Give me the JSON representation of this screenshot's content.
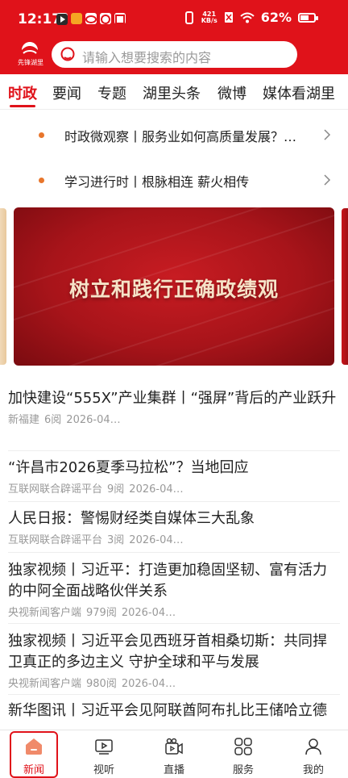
{
  "status_bar": {
    "time": "12:17",
    "net_speed_value": "421",
    "net_speed_unit": "KB/s",
    "battery_percent": "62%",
    "battery_level": 0.62
  },
  "header": {
    "logo_text": "先锋湖里",
    "search_placeholder": "请输入想要搜索的内容"
  },
  "tabs": [
    {
      "label": "时政"
    },
    {
      "label": "要闻"
    },
    {
      "label": "专题"
    },
    {
      "label": "湖里头条"
    },
    {
      "label": "微博"
    },
    {
      "label": "媒体看湖里"
    }
  ],
  "headlines": [
    {
      "text": "时政微观察丨服务业如何高质量发展？…"
    },
    {
      "text": "学习进行时丨根脉相连 薪火相传"
    }
  ],
  "banner": {
    "title": "树立和践行正确政绩观"
  },
  "news": [
    {
      "title": "加快建设“555X”产业集群丨“强屏”背后的产业跃升",
      "source": "新福建",
      "reads": "6阅",
      "date": "2026-04…"
    },
    {
      "title": "“许昌市2026夏季马拉松”？当地回应",
      "source": "互联网联合辟谣平台",
      "reads": "9阅",
      "date": "2026-04…"
    },
    {
      "title": "人民日报：警惕财经类自媒体三大乱象",
      "source": "互联网联合辟谣平台",
      "reads": "3阅",
      "date": "2026-04…"
    },
    {
      "title": "独家视频丨习近平：打造更加稳固坚韧、富有活力的中阿全面战略伙伴关系",
      "source": "央视新闻客户端",
      "reads": "979阅",
      "date": "2026-04…"
    },
    {
      "title": "独家视频丨习近平会见西班牙首相桑切斯：共同捍卫真正的多边主义 守护全球和平与发展",
      "source": "央视新闻客户端",
      "reads": "980阅",
      "date": "2026-04…"
    },
    {
      "title": "新华图讯丨习近平会见阿联酋阿布扎比王储哈立德",
      "source": "",
      "reads": "",
      "date": ""
    }
  ],
  "bottom_nav": [
    {
      "label": "新闻",
      "icon": "home-icon"
    },
    {
      "label": "视听",
      "icon": "video-icon"
    },
    {
      "label": "直播",
      "icon": "live-camera-icon"
    },
    {
      "label": "服务",
      "icon": "grid-icon"
    },
    {
      "label": "我的",
      "icon": "person-icon"
    }
  ],
  "colors": {
    "brand_red": "#e0121a",
    "dot_orange": "#e8762c"
  }
}
